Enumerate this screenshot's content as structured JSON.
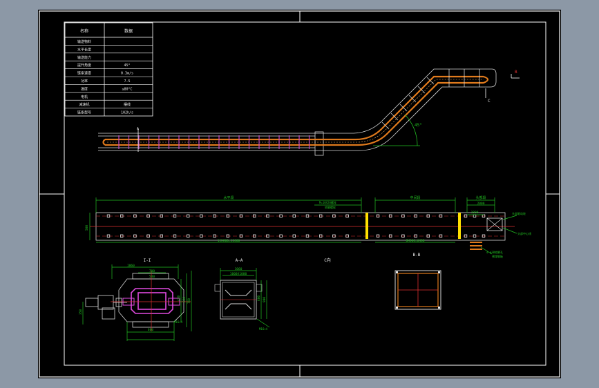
{
  "colors": {
    "backdrop": "#8c98a6",
    "sheet": "#000000",
    "frame": "#ffffff",
    "dimension": "#22c022",
    "chain": "#e07a1c",
    "centerline": "#e03030",
    "highlight": "#e04ae0",
    "marker": "#ffe000"
  },
  "parameter_table": {
    "header": [
      "名称",
      "数据"
    ],
    "rows": [
      {
        "label": "输送物料",
        "value": ""
      },
      {
        "label": "水平长度",
        "value": ""
      },
      {
        "label": "输送能力",
        "value": ""
      },
      {
        "label": "提升角度",
        "value": "45°"
      },
      {
        "label": "链条速度",
        "value": "0.3m/s"
      },
      {
        "label": "功率",
        "value": "7.5"
      },
      {
        "label": "温度",
        "value": "≤80°C"
      },
      {
        "label": "电机",
        "value": ""
      },
      {
        "label": "减速机",
        "value": "摆线"
      },
      {
        "label": "链条型号",
        "value": "102h/s"
      }
    ]
  },
  "elevation": {
    "angle_label": "45°",
    "marker_a": "A",
    "marker_b": "B",
    "marker_c": "C"
  },
  "plan": {
    "dim_left": "水平段",
    "dim_mid": "中间段",
    "dim_right": "头部段",
    "dim_left_bottom": "15X800=12000",
    "dim_mid_bottom": "8X800=6400",
    "dim_right_top": "2000",
    "dim_height": "500",
    "dim_right_small": "1000",
    "callout_top": "M=10X20螺栓",
    "callout_top_2": "地脚螺栓",
    "callout_right_1": "头部驱动轮",
    "callout_right_2": "头部中心线",
    "callout_bottom_1": "4-φ30地脚孔",
    "callout_bottom_2": "预埋钢板"
  },
  "section_titles": {
    "drive_view": "I-I",
    "section_aa": "A-A",
    "section_c": "C向",
    "section_bb": "B-B"
  },
  "drive_view": {
    "dim_top": "1060",
    "dim_inner": "700",
    "dim_inner_2": "540",
    "dim_bottom": "600",
    "dim_side_1": "420",
    "dim_side_2": "620",
    "dim_side_3": "760",
    "dim_left": "350",
    "dim_right_note": "M16×4"
  },
  "section_aa": {
    "dim_top": "1060",
    "dim_inner": "1000X1000",
    "dim_right_1": "600",
    "dim_right_2": "900",
    "dim_bottom_note": "M16×4"
  }
}
